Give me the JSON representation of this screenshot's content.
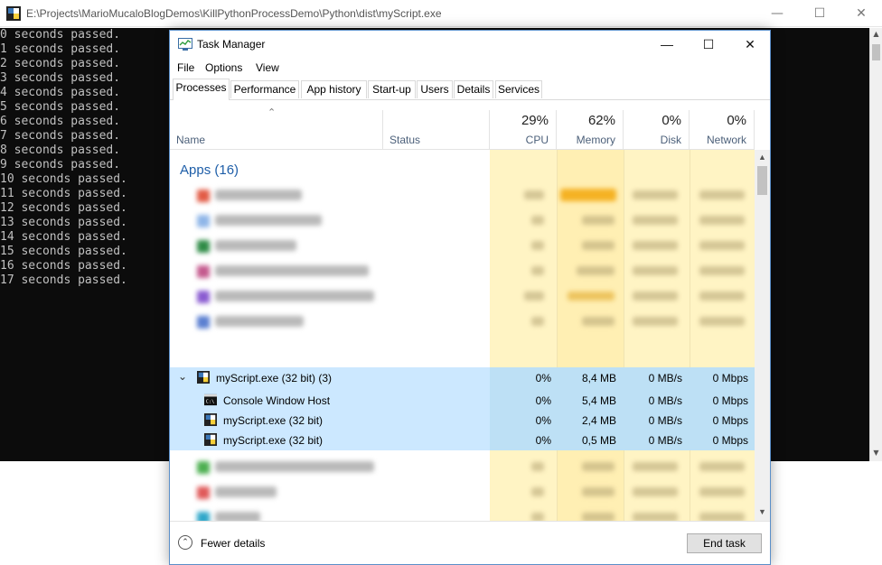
{
  "console": {
    "title": "E:\\Projects\\MarioMucaloBlogDemos\\KillPythonProcessDemo\\Python\\dist\\myScript.exe",
    "lines": [
      "0 seconds passed.",
      "1 seconds passed.",
      "2 seconds passed.",
      "3 seconds passed.",
      "4 seconds passed.",
      "5 seconds passed.",
      "6 seconds passed.",
      "7 seconds passed.",
      "8 seconds passed.",
      "9 seconds passed.",
      "10 seconds passed.",
      "11 seconds passed.",
      "12 seconds passed.",
      "13 seconds passed.",
      "14 seconds passed.",
      "15 seconds passed.",
      "16 seconds passed.",
      "17 seconds passed."
    ]
  },
  "taskmanager": {
    "title": "Task Manager",
    "menu": [
      "File",
      "Options",
      "View"
    ],
    "tabs": [
      "Processes",
      "Performance",
      "App history",
      "Start-up",
      "Users",
      "Details",
      "Services"
    ],
    "active_tab": "Processes",
    "columns": {
      "name": "Name",
      "status": "Status",
      "cpu": {
        "pct": "29%",
        "label": "CPU"
      },
      "memory": {
        "pct": "62%",
        "label": "Memory"
      },
      "disk": {
        "pct": "0%",
        "label": "Disk"
      },
      "network": {
        "pct": "0%",
        "label": "Network"
      }
    },
    "group_label": "Apps (16)",
    "expanded_process": {
      "name": "myScript.exe (32 bit) (3)",
      "cpu": "0%",
      "memory": "8,4 MB",
      "disk": "0 MB/s",
      "network": "0 Mbps"
    },
    "children": [
      {
        "name": "Console Window Host",
        "cpu": "0%",
        "memory": "5,4 MB",
        "disk": "0 MB/s",
        "network": "0 Mbps"
      },
      {
        "name": "myScript.exe (32 bit)",
        "cpu": "0%",
        "memory": "2,4 MB",
        "disk": "0 MB/s",
        "network": "0 Mbps"
      },
      {
        "name": "myScript.exe (32 bit)",
        "cpu": "0%",
        "memory": "0,5 MB",
        "disk": "0 MB/s",
        "network": "0 Mbps"
      }
    ],
    "footer": {
      "fewer_details": "Fewer details",
      "end_task": "End task"
    },
    "colors": {
      "heat_light": "#fff4c4",
      "heat_mid": "#ffe7a3",
      "selection": "#cce8ff",
      "accent": "#1e5ea8"
    }
  }
}
